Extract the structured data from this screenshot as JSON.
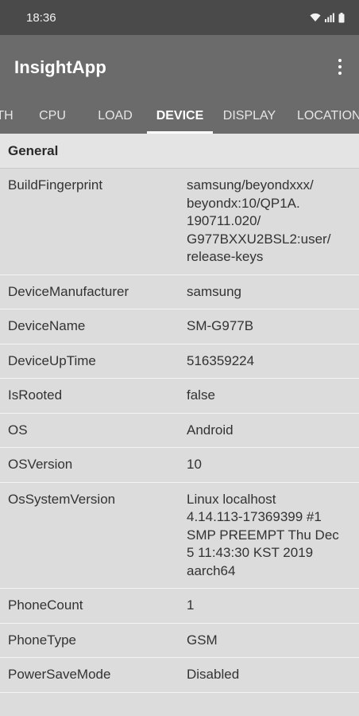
{
  "status_bar": {
    "time": "18:36",
    "icons": [
      "wifi-icon",
      "signal-icon",
      "battery-icon"
    ]
  },
  "app_bar": {
    "title": "InsightApp",
    "menu_icon": "more-vert-icon"
  },
  "tabs": [
    {
      "label": "TH",
      "active": false
    },
    {
      "label": "CPU",
      "active": false
    },
    {
      "label": "LOAD",
      "active": false
    },
    {
      "label": "DEVICE",
      "active": true
    },
    {
      "label": "DISPLAY",
      "active": false
    },
    {
      "label": "LOCATION",
      "active": false
    }
  ],
  "section": {
    "title": "General"
  },
  "rows": [
    {
      "key": "BuildFingerprint",
      "value": [
        "samsung/beyondxxx/",
        "beyondx:10/QP1A.",
        "190711.020/",
        "G977BXXU2BSL2:user/",
        "release-keys"
      ]
    },
    {
      "key": "DeviceManufacturer",
      "value": [
        "samsung"
      ]
    },
    {
      "key": "DeviceName",
      "value": [
        "SM-G977B"
      ]
    },
    {
      "key": "DeviceUpTime",
      "value": [
        "516359224"
      ]
    },
    {
      "key": "IsRooted",
      "value": [
        "false"
      ]
    },
    {
      "key": "OS",
      "value": [
        "Android"
      ]
    },
    {
      "key": "OSVersion",
      "value": [
        "10"
      ]
    },
    {
      "key": "OsSystemVersion",
      "value": [
        "Linux localhost",
        "4.14.113-17369399 #1",
        "SMP PREEMPT Thu Dec",
        "5 11:43:30 KST 2019",
        "aarch64"
      ]
    },
    {
      "key": "PhoneCount",
      "value": [
        "1"
      ]
    },
    {
      "key": "PhoneType",
      "value": [
        "GSM"
      ]
    },
    {
      "key": "PowerSaveMode",
      "value": [
        "Disabled"
      ]
    }
  ],
  "colors": {
    "status_bar": "#4a4a4a",
    "app_bar": "#6b6b6b",
    "content_bg": "#dcdcdc",
    "divider": "#f4f4f4"
  }
}
